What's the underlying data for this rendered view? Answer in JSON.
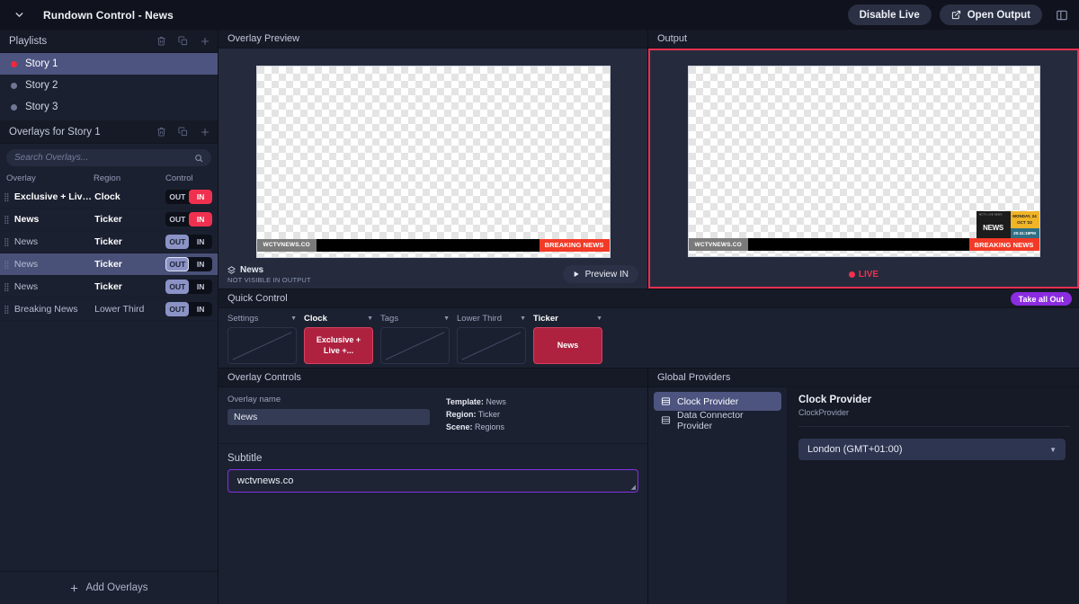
{
  "titlebar": {
    "collapse_icon": "chevron-down-icon",
    "title": "Rundown Control - News",
    "disable_live_label": "Disable Live",
    "open_output_label": "Open Output",
    "open_output_icon": "external-link-icon",
    "panel_toggle_icon": "panel-layout-icon"
  },
  "sidebar": {
    "playlists": {
      "header": "Playlists",
      "tools": [
        "trash-icon",
        "duplicate-icon",
        "plus-icon"
      ],
      "items": [
        {
          "label": "Story 1",
          "live": true,
          "selected": true
        },
        {
          "label": "Story 2",
          "live": false,
          "selected": false
        },
        {
          "label": "Story 3",
          "live": false,
          "selected": false
        }
      ]
    },
    "overlays": {
      "header": "Overlays for Story 1",
      "tools": [
        "trash-icon",
        "duplicate-icon",
        "plus-icon"
      ],
      "search_placeholder": "Search Overlays...",
      "search_value": "",
      "columns": [
        "Overlay",
        "Region",
        "Control"
      ],
      "out_label": "OUT",
      "in_label": "IN",
      "rows": [
        {
          "overlay": "Exclusive + Live ...",
          "region": "Clock",
          "state": "IN",
          "selected": false,
          "active": true
        },
        {
          "overlay": "News",
          "region": "Ticker",
          "state": "IN",
          "selected": false,
          "active": true
        },
        {
          "overlay": "News",
          "region": "Ticker",
          "state": "OUT",
          "selected": false,
          "active": false
        },
        {
          "overlay": "News",
          "region": "Ticker",
          "state": "OUT",
          "selected": true,
          "active": false
        },
        {
          "overlay": "News",
          "region": "Ticker",
          "state": "OUT",
          "selected": false,
          "active": false
        },
        {
          "overlay": "Breaking News",
          "region": "Lower Third",
          "state": "OUT",
          "selected": false,
          "active": false
        }
      ]
    },
    "add_overlays_label": "Add Overlays"
  },
  "preview": {
    "header": "Overlay Preview",
    "graphic": {
      "logo_text": "WCTVNEWS.CO",
      "breaking_text": "BREAKING NEWS"
    },
    "footer": {
      "name": "News",
      "name_icon": "layers-icon",
      "status": "NOT VISIBLE IN OUTPUT",
      "button_label": "Preview IN",
      "button_icon": "play-icon"
    }
  },
  "output": {
    "header": "Output",
    "graphic": {
      "logo_text": "WCTVNEWS.CO",
      "breaking_text": "BREAKING NEWS",
      "clock_channel": "WCTV LIVE NEWS",
      "clock_logo": "NEWS",
      "clock_date_line1": "MONDAY, 24",
      "clock_date_line2": "OCT '22",
      "clock_time": "20:41:18PM"
    },
    "live_label": "LIVE",
    "live_color": "#f0304f",
    "border_color": "#e8314f"
  },
  "quick_control": {
    "header": "Quick Control",
    "take_all_out_label": "Take all Out",
    "take_all_out_color": "#8b2ce0",
    "columns": [
      {
        "label": "Settings",
        "active": false,
        "card_label": "",
        "card_filled": false
      },
      {
        "label": "Clock",
        "active": true,
        "card_label": "Exclusive + Live +...",
        "card_filled": true
      },
      {
        "label": "Tags",
        "active": false,
        "card_label": "",
        "card_filled": false
      },
      {
        "label": "Lower Third",
        "active": false,
        "card_label": "",
        "card_filled": false
      },
      {
        "label": "Ticker",
        "active": true,
        "card_label": "News",
        "card_filled": true
      }
    ]
  },
  "overlay_controls": {
    "header": "Overlay Controls",
    "name_label": "Overlay name",
    "name_value": "News",
    "meta": [
      {
        "key": "Template:",
        "value": "News"
      },
      {
        "key": "Region:",
        "value": "Ticker"
      },
      {
        "key": "Scene:",
        "value": "Regions"
      }
    ],
    "subtitle_label": "Subtitle",
    "subtitle_value": "wctvnews.co",
    "subtitle_border_color": "#8432e6"
  },
  "global_providers": {
    "header": "Global Providers",
    "items": [
      {
        "label": "Clock Provider",
        "icon": "database-icon",
        "selected": true
      },
      {
        "label": "Data Connector Provider",
        "icon": "database-icon",
        "selected": false
      }
    ],
    "detail": {
      "title": "Clock Provider",
      "subtitle": "ClockProvider",
      "timezone_value": "London (GMT+01:00)"
    }
  }
}
